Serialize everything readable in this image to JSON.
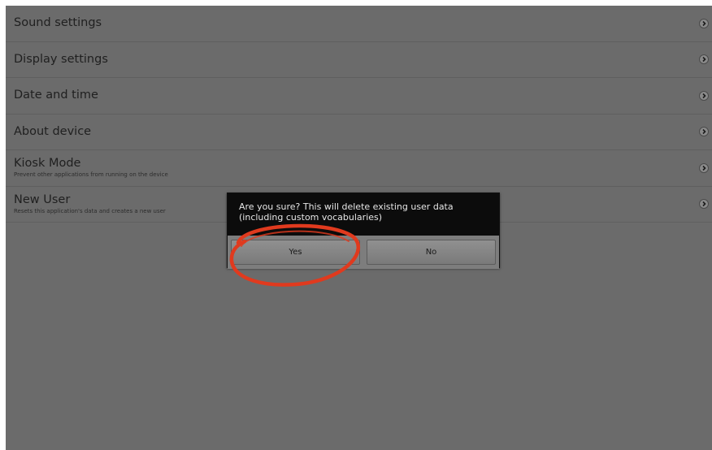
{
  "settings": {
    "items": [
      {
        "title": "Sound settings",
        "subtitle": ""
      },
      {
        "title": "Display settings",
        "subtitle": ""
      },
      {
        "title": "Date and time",
        "subtitle": ""
      },
      {
        "title": "About device",
        "subtitle": ""
      },
      {
        "title": "Kiosk Mode",
        "subtitle": "Prevent other applications from running on the device"
      },
      {
        "title": "New User",
        "subtitle": "Resets this application's data and creates a new user"
      }
    ],
    "chevron_icon": "chevron-right-icon"
  },
  "dialog": {
    "message": "Are you sure? This will delete existing user data (including custom vocabularies)",
    "yes_label": "Yes",
    "no_label": "No"
  },
  "annotation": {
    "shape": "ellipse",
    "color": "#e03a1e",
    "target": "yes-button"
  },
  "colors": {
    "overlay": "#6b6b6b",
    "dialog_bg": "#0c0c0c",
    "button_bar": "#7d7d7d"
  }
}
